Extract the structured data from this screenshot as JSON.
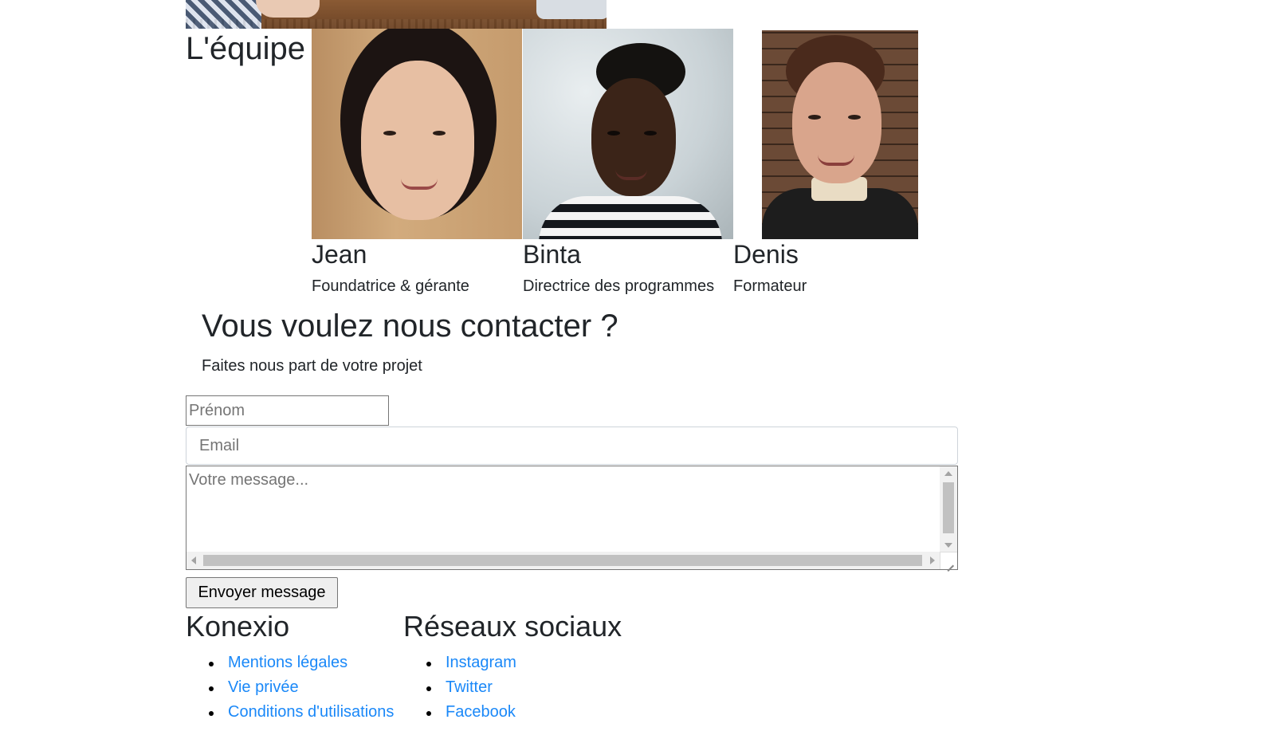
{
  "team": {
    "title": "L'équipe",
    "members": [
      {
        "name": "Jean",
        "role": "Foundatrice & gérante"
      },
      {
        "name": "Binta",
        "role": "Directrice des programmes"
      },
      {
        "name": "Denis",
        "role": "Formateur"
      }
    ]
  },
  "contact": {
    "title": "Vous voulez nous contacter ?",
    "subtitle": "Faites nous part de votre projet",
    "firstname_placeholder": "Prénom",
    "email_placeholder": "Email",
    "message_placeholder": "Votre message...",
    "submit_label": "Envoyer message"
  },
  "footer": {
    "company": {
      "title": "Konexio",
      "links": [
        "Mentions légales",
        "Vie privée",
        "Conditions d'utilisations"
      ]
    },
    "social": {
      "title": "Réseaux sociaux",
      "links": [
        "Instagram",
        "Twitter",
        "Facebook"
      ]
    }
  },
  "colors": {
    "link": "#1a88f8",
    "text": "#212529",
    "button_bg": "#efefef"
  }
}
